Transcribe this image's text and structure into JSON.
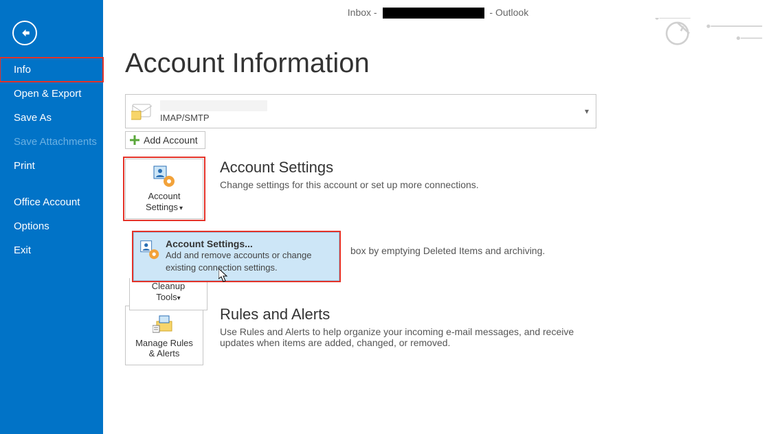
{
  "titlebar": {
    "prefix": "Inbox - ",
    "suffix": " - Outlook"
  },
  "sidebar": {
    "items": [
      {
        "label": "Info",
        "selected": true
      },
      {
        "label": "Open & Export",
        "selected": false
      },
      {
        "label": "Save As",
        "selected": false
      },
      {
        "label": "Save Attachments",
        "selected": false,
        "disabled": true
      },
      {
        "label": "Print",
        "selected": false
      }
    ],
    "lowerItems": [
      {
        "label": "Office Account"
      },
      {
        "label": "Options"
      },
      {
        "label": "Exit"
      }
    ]
  },
  "page": {
    "title": "Account Information",
    "account_type": "IMAP/SMTP",
    "add_account": "Add Account"
  },
  "accountSettings": {
    "tile_label_line1": "Account",
    "tile_label_line2": "Settings",
    "title": "Account Settings",
    "desc": "Change settings for this account or set up more connections."
  },
  "flyout": {
    "title": "Account Settings...",
    "desc": "Add and remove accounts or change existing connection settings."
  },
  "cleanup": {
    "tile_label_line1": "Cleanup",
    "tile_label_line2": "Tools",
    "desc_fragment": "box by emptying Deleted Items and archiving."
  },
  "rules": {
    "tile_label_line1": "Manage Rules",
    "tile_label_line2": "& Alerts",
    "title": "Rules and Alerts",
    "desc": "Use Rules and Alerts to help organize your incoming e-mail messages, and receive updates when items are added, changed, or removed."
  }
}
